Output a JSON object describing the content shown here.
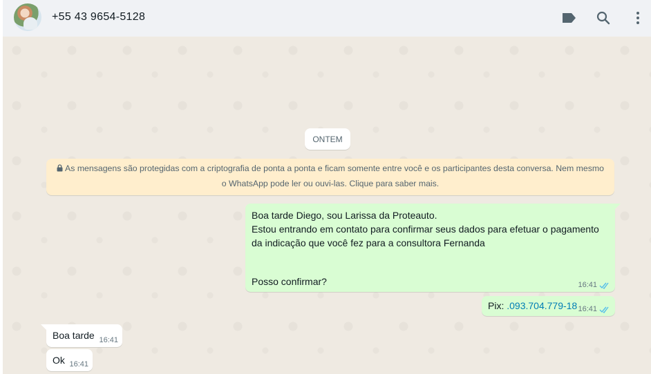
{
  "header": {
    "contact_name": "+55 43 9654-5128",
    "icons": [
      "label-icon",
      "search-icon",
      "menu-icon"
    ]
  },
  "chat": {
    "day_chip": "ONTEM",
    "encryption_notice": {
      "line1": "As mensagens são protegidas com a criptografia de ponta a ponta e ficam somente entre você e os participantes desta conversa. Nem mesmo",
      "line2": "o WhatsApp pode ler ou ouvi-las. Clique para saber mais."
    },
    "messages": [
      {
        "direction": "outgoing",
        "lines": [
          "Boa tarde Diego, sou Larissa da Proteauto.",
          "Estou entrando em contato para confirmar seus dados para efetuar o pagamento",
          "da indicação que você fez para a consultora Fernanda",
          "Posso confirmar?"
        ],
        "time": "16:41",
        "status": "read"
      },
      {
        "direction": "outgoing",
        "label": "Pix: ",
        "link": ".093.704.779-18",
        "time": "16:41",
        "status": "read"
      },
      {
        "direction": "incoming",
        "text": "Boa tarde",
        "time": "16:41"
      },
      {
        "direction": "incoming",
        "text": "Ok",
        "time": "16:41"
      }
    ]
  },
  "colors": {
    "header_bg": "#f0f2f5",
    "chat_bg": "#efeae2",
    "outgoing_bubble": "#d9fdd3",
    "incoming_bubble": "#ffffff",
    "notice_bg": "#ffeecd",
    "read_ticks": "#53bdeb",
    "link": "#027eb5"
  }
}
